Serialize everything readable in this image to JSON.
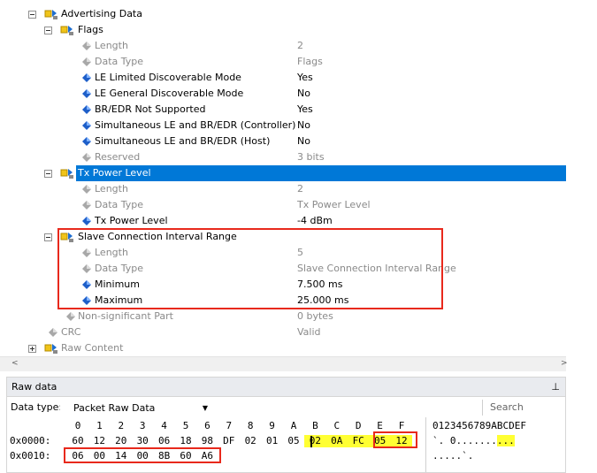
{
  "tree": {
    "rows": [
      {
        "label": "Advertising Data",
        "value": "",
        "icon": "structure-icon",
        "expander": "minus"
      },
      {
        "label": "Flags",
        "value": "",
        "icon": "structure-icon",
        "expander": "minus"
      },
      {
        "label": "Length",
        "value": "2",
        "icon": "field-gray-icon",
        "dim": true
      },
      {
        "label": "Data Type",
        "value": "Flags",
        "icon": "field-gray-icon",
        "dim": true
      },
      {
        "label": "LE Limited Discoverable Mode",
        "value": "Yes",
        "icon": "field-blue-icon"
      },
      {
        "label": "LE General Discoverable Mode",
        "value": "No",
        "icon": "field-blue-icon"
      },
      {
        "label": "BR/EDR Not Supported",
        "value": "Yes",
        "icon": "field-blue-icon"
      },
      {
        "label": "Simultaneous LE and BR/EDR (Controller)",
        "value": "No",
        "icon": "field-blue-icon"
      },
      {
        "label": "Simultaneous LE and BR/EDR (Host)",
        "value": "No",
        "icon": "field-blue-icon"
      },
      {
        "label": "Reserved",
        "value": "3 bits",
        "icon": "field-gray-icon",
        "dim": true
      },
      {
        "label": "Tx Power Level",
        "value": "",
        "icon": "structure-icon",
        "expander": "minus",
        "selected": true
      },
      {
        "label": "Length",
        "value": "2",
        "icon": "field-gray-icon",
        "dim": true
      },
      {
        "label": "Data Type",
        "value": "Tx Power Level",
        "icon": "field-gray-icon",
        "dim": true
      },
      {
        "label": "Tx Power Level",
        "value": "-4 dBm",
        "icon": "field-blue-icon"
      },
      {
        "label": "Slave Connection Interval Range",
        "value": "",
        "icon": "structure-icon",
        "expander": "minus"
      },
      {
        "label": "Length",
        "value": "5",
        "icon": "field-gray-icon",
        "dim": true
      },
      {
        "label": "Data Type",
        "value": "Slave Connection Interval Range",
        "icon": "field-gray-icon",
        "dim": true
      },
      {
        "label": "Minimum",
        "value": "7.500 ms",
        "icon": "field-blue-icon"
      },
      {
        "label": "Maximum",
        "value": "25.000 ms",
        "icon": "field-blue-icon"
      },
      {
        "label": "Non-significant Part",
        "value": "0 bytes",
        "icon": "field-gray-icon",
        "dim": true
      },
      {
        "label": "CRC",
        "value": "Valid",
        "icon": "field-gray-icon",
        "dim": true
      },
      {
        "label": "Raw Content",
        "value": "",
        "icon": "structure-icon",
        "expander": "plus",
        "dim": true
      }
    ]
  },
  "scrollbar": {
    "left_arrow": "<",
    "right_arrow": ">"
  },
  "raw_data": {
    "title": "Raw data",
    "pin_glyph": "⊥",
    "data_type_label": "Data type:",
    "data_type_value": "Packet Raw Data",
    "search_placeholder": "Search",
    "column_header": [
      "0",
      "1",
      "2",
      "3",
      "4",
      "5",
      "6",
      "7",
      "8",
      "9",
      "A",
      "B",
      "C",
      "D",
      "E",
      "F"
    ],
    "ascii_header": "0123456789ABCDEF",
    "rows": [
      {
        "offset": "0x0000:",
        "bytes": [
          "60",
          "12",
          "20",
          "30",
          "06",
          "18",
          "98",
          "DF",
          "02",
          "01",
          "05",
          "02",
          "0A",
          "FC",
          "05",
          "12"
        ],
        "highlighted": [
          11,
          12,
          13,
          14,
          15
        ],
        "ascii": "`. 0.......",
        "ascii_highlight": "..."
      },
      {
        "offset": "0x0010:",
        "bytes": [
          "06",
          "00",
          "14",
          "00",
          "8B",
          "60",
          "A6"
        ],
        "highlighted": [],
        "ascii": ".....`."
      }
    ]
  },
  "colors": {
    "selection": "#0078d7",
    "highlight_box": "#e8291c",
    "byte_highlight": "#ffff33"
  }
}
